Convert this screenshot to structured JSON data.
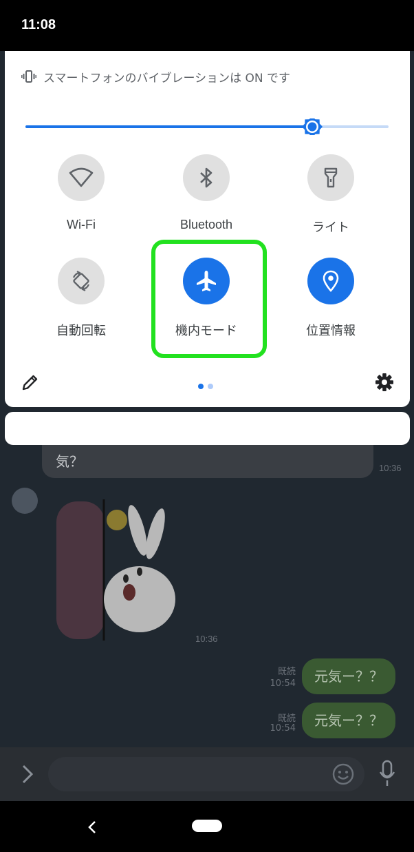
{
  "status_bar": {
    "time": "11:08"
  },
  "quick_settings": {
    "vibration_message": "スマートフォンのバイブレーションは ON です",
    "brightness_level": 0.79,
    "tiles": [
      {
        "label": "Wi-Fi",
        "icon": "wifi-icon",
        "active": false
      },
      {
        "label": "Bluetooth",
        "icon": "bluetooth-icon",
        "active": false
      },
      {
        "label": "ライト",
        "icon": "flashlight-icon",
        "active": false
      },
      {
        "label": "自動回転",
        "icon": "auto-rotate-icon",
        "active": false
      },
      {
        "label": "機内モード",
        "icon": "airplane-icon",
        "active": true
      },
      {
        "label": "位置情報",
        "icon": "location-icon",
        "active": true
      }
    ],
    "page_dots": 2,
    "active_page": 1,
    "accent_color": "#1a73e8",
    "highlight_color": "#22e11f"
  },
  "chat": {
    "incoming_text": "気？",
    "incoming_time": "10:36",
    "sticker_time": "10:36",
    "outgoing": [
      {
        "text": "元気ー？？",
        "read": "既読",
        "time": "10:54"
      },
      {
        "text": "元気ー？？",
        "read": "既読",
        "time": "10:54"
      }
    ]
  }
}
